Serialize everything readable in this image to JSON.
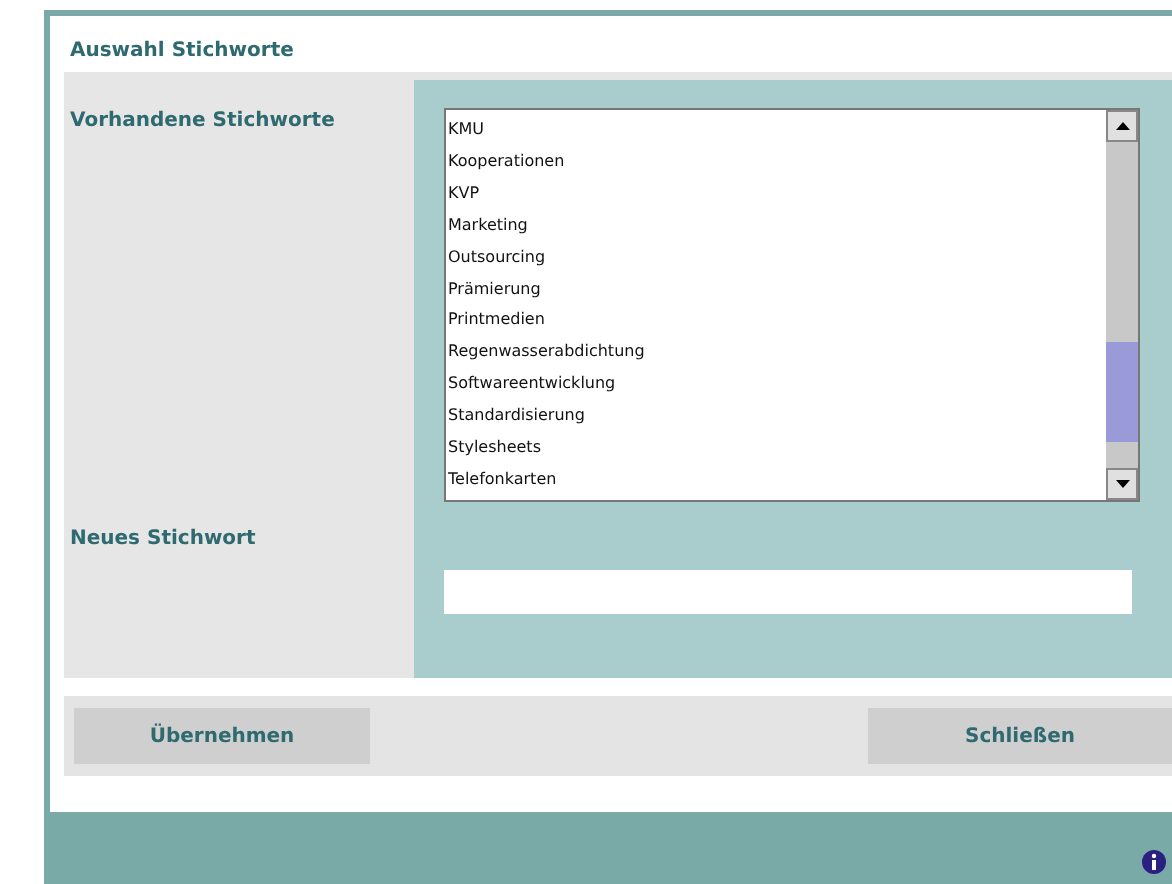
{
  "dialog": {
    "title": "Auswahl Stichworte"
  },
  "keywords": {
    "label": "Vorhandene Stichworte",
    "items": [
      {
        "text": "KMU",
        "selected": false
      },
      {
        "text": "Kooperationen",
        "selected": false
      },
      {
        "text": "KVP",
        "selected": false
      },
      {
        "text": "Marketing",
        "selected": false
      },
      {
        "text": "Outsourcing",
        "selected": false
      },
      {
        "text": "Prämierung",
        "selected": false
      },
      {
        "text": "Printmedien",
        "selected": false
      },
      {
        "text": "Regenwasserabdichtung",
        "selected": false
      },
      {
        "text": "Softwareentwicklung",
        "selected": false
      },
      {
        "text": "Standardisierung",
        "selected": false
      },
      {
        "text": "Stylesheets",
        "selected": false
      },
      {
        "text": "Telefonkarten",
        "selected": false
      }
    ]
  },
  "new_keyword": {
    "label": "Neues Stichwort"
  },
  "buttons": [
    {
      "label": "Übernehmen",
      "kind": "left"
    },
    {
      "label": "Schließen",
      "kind": "right"
    }
  ]
}
